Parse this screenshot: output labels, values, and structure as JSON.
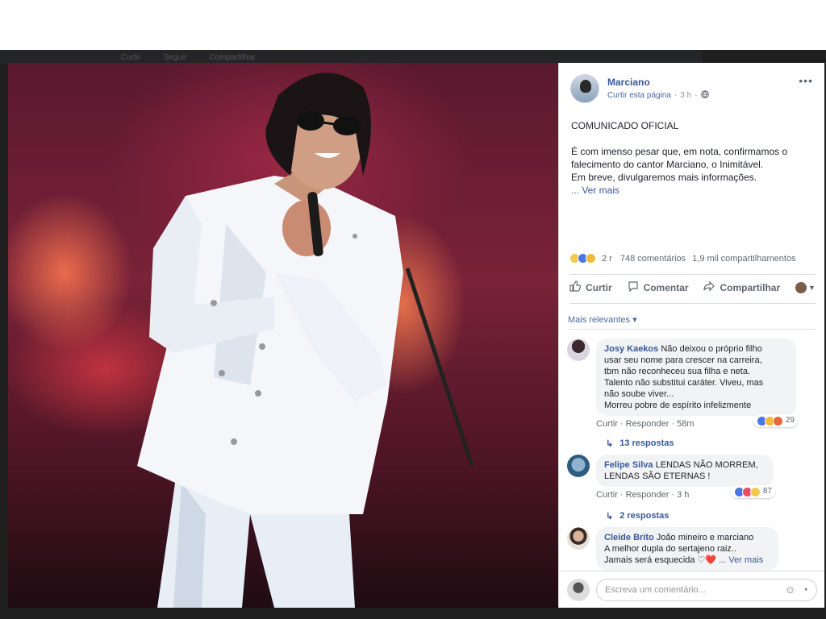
{
  "background_bar": {
    "items": [
      "Curtir",
      "Seguir",
      "Compartilhar"
    ]
  },
  "post": {
    "page_name": "Marciano",
    "follow_label": "Curtir esta página",
    "time": "3 h",
    "globe_icon": "globe-icon",
    "more_icon": "more-options-icon",
    "heading": "COMUNICADO OFICIAL",
    "body_line1": "É com imenso pesar que, em nota, confirmamos o falecimento do cantor Marciano, o Inimitável.",
    "body_line2": "Em breve, divulgaremos mais informações.",
    "see_more": "... Ver mais",
    "reaction_count": "2 r",
    "comments_count": "748 comentários",
    "shares_count": "1,9 mil compartilhamentos",
    "actions": {
      "like": "Curtir",
      "comment": "Comentar",
      "share": "Compartilhar"
    }
  },
  "comments_section": {
    "sort_label": "Mais relevantes ▾",
    "comments": [
      {
        "name": "Josy Kaekos",
        "text_lines": [
          "Não deixou o próprio filho",
          "usar seu nome para crescer na carreira,",
          "tbm não reconheceu sua filha e neta.",
          "Talento não substitui caráter. Viveu, mas",
          "não soube viver...",
          "Morreu pobre de espírito infelizmente"
        ],
        "like_label": "Curtir",
        "reply_label": "Responder",
        "time": "58m",
        "reaction_count": "29",
        "replies": "13 respostas"
      },
      {
        "name": "Felipe Silva",
        "text_lines": [
          "LENDAS NÃO MORREM,",
          "LENDAS SÃO ETERNAS !"
        ],
        "like_label": "Curtir",
        "reply_label": "Responder",
        "time": "3 h",
        "reaction_count": "87",
        "replies": "2 respostas"
      },
      {
        "name": "Cleide Brito",
        "text_lines": [
          "João mineiro e marciano",
          "A melhor dupla do sertajeno raiz..",
          "Jamais será esquecida ♡❤️"
        ],
        "see_more": "... Ver mais"
      }
    ],
    "composer_placeholder": "Escreva um comentário..."
  },
  "colors": {
    "fb_blue": "#385898",
    "text": "#1d2129",
    "muted": "#606770"
  }
}
